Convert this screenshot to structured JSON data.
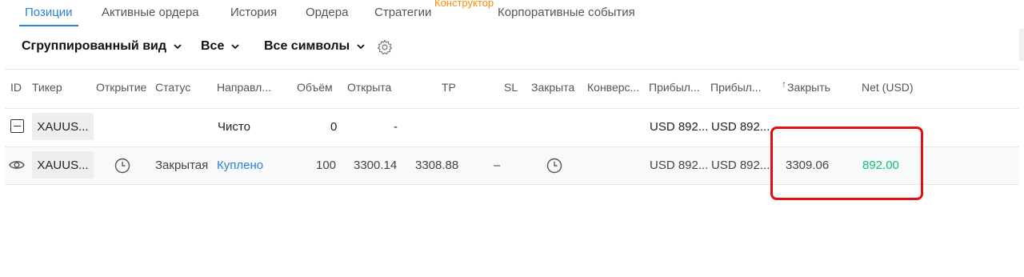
{
  "tabs": [
    {
      "label": "Позиции",
      "active": true
    },
    {
      "label": "Активные ордера",
      "active": false
    },
    {
      "label": "История",
      "active": false
    },
    {
      "label": "Ордера",
      "active": false
    },
    {
      "label": "Стратегии",
      "active": false
    },
    {
      "label": "Корпоративные события",
      "active": false
    }
  ],
  "tab_constructor": "Конструктор",
  "toolbar": {
    "grouped_view": "Сгруппированный вид",
    "filter_all": "Все",
    "all_symbols": "Все символы"
  },
  "columns": [
    "ID",
    "Тикер",
    "Открытие",
    "Статус",
    "Направл...",
    "Объём",
    "Открыта",
    "TP",
    "SL",
    "Закрыта",
    "Конверс...",
    "Прибыл...",
    "Прибыл...",
    "Закрыть",
    "Net (USD)"
  ],
  "close_sort_arrow": "↑",
  "group_row": {
    "ticker": "XAUUS...",
    "direction": "Чисто",
    "volume": "0",
    "open_price": "-",
    "profit1": "USD 892...",
    "profit2": "USD 892..."
  },
  "position_row": {
    "ticker": "XAUUS...",
    "status": "Закрытая",
    "direction": "Куплено",
    "volume": "100",
    "open_price": "3300.14",
    "tp": "3308.88",
    "sl": "–",
    "profit1": "USD 892...",
    "profit2": "USD 892...",
    "close": "3309.06",
    "net": "892.00"
  },
  "colors": {
    "accent": "#2e7fd6",
    "constructor": "#ff8a00",
    "positive": "#10c070",
    "highlight": "#e01010"
  }
}
